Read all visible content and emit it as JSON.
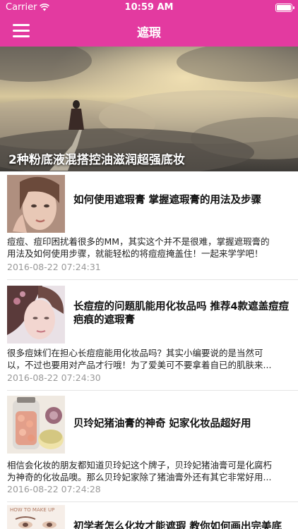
{
  "status_bar": {
    "carrier": "Carrier",
    "time": "10:59 AM"
  },
  "nav": {
    "title": "遮瑕",
    "menu_icon": "hamburger-menu-icon"
  },
  "hero": {
    "title": "2种粉底液混搭控油滋润超强底妆"
  },
  "articles": [
    {
      "title": "如何使用遮瑕膏 掌握遮瑕膏的用法及步骤",
      "summary_line1": "痘痘、痘印困扰着很多的MM，其实这个并不是很难，掌握遮瑕膏的",
      "summary_line2": "用法及如何使用步骤，就能轻松的将痘痘掩盖住！一起来学学吧！",
      "date": "2016-08-22 07:24:31"
    },
    {
      "title_line1": "长痘痘的问题肌能用化妆品吗 推荐4款遮盖痘痘",
      "title_line2": "疤痕的遮瑕膏",
      "summary_line1": "很多痘妹们在担心长痘痘能用化妆品吗？其实小编要说的是当然可",
      "summary_line2": "以，不过也要用对产品才行哦！为了爱美可不要拿着自已的肌肤来...",
      "date": "2016-08-22 07:24:30"
    },
    {
      "title": "贝玲妃猪油膏的神奇 妃家化妆品超好用",
      "summary_line1": "相信会化妆的朋友都知道贝玲妃这个牌子，贝玲妃猪油膏可是化腐朽",
      "summary_line2": "为神奇的化妆品噢。那么贝玲妃家除了猪油膏外还有其它非常好用...",
      "date": "2016-08-22 07:24:28"
    },
    {
      "thumb_caption": "HOW TO MAKE UP",
      "title": "初学者怎么化妆才能遮瑕 教你如何画出完美底"
    }
  ]
}
